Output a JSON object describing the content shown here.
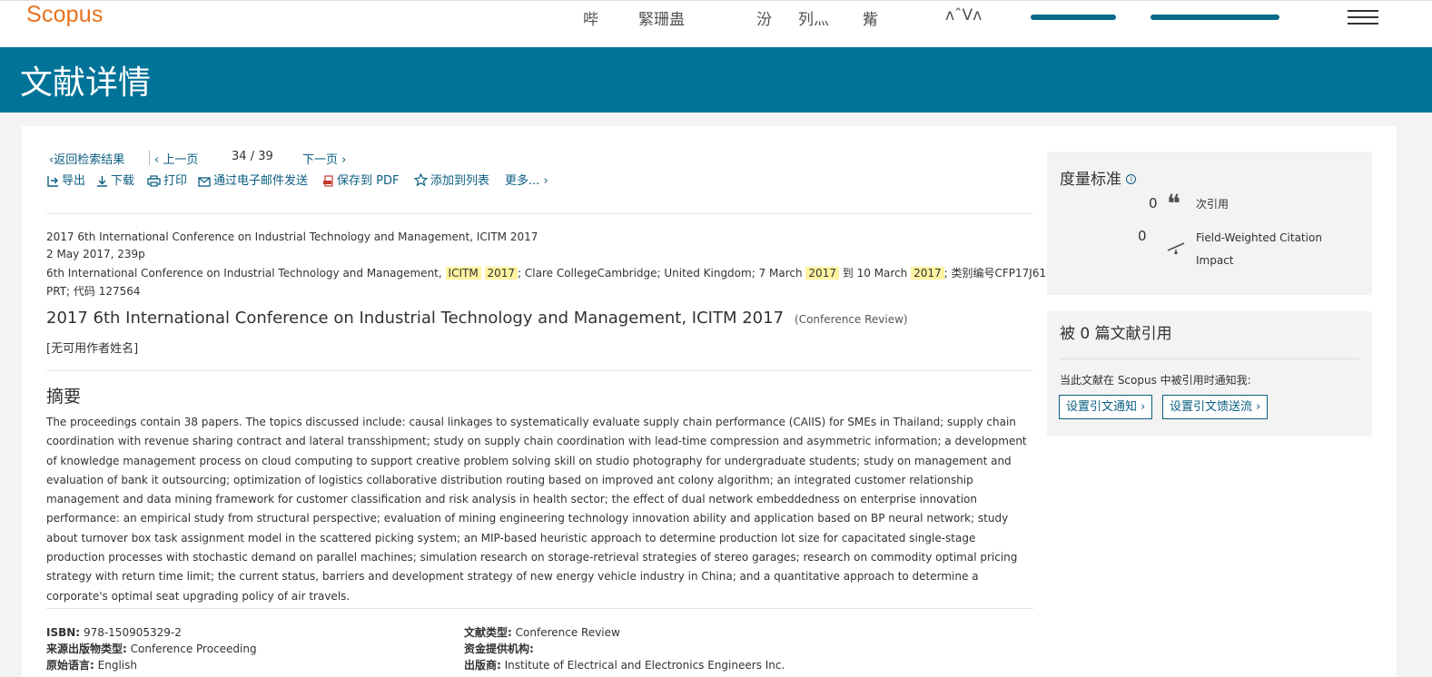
{
  "header": {
    "logo": "Scopus",
    "garbled_nav": [
      "哔",
      "緊珊蛊",
      "汾",
      "列灬",
      "觜",
      "ᴧˆVʌ"
    ]
  },
  "banner": {
    "title": "文献详情"
  },
  "nav": {
    "back": "返回检索结果",
    "prev": "上一页",
    "current": "34",
    "slash": "/",
    "total": "39",
    "next": "下一页"
  },
  "toolbar": {
    "export": "导出",
    "download": "下载",
    "print": "打印",
    "email": "通过电子邮件发送",
    "pdf": "保存到 PDF",
    "add_list": "添加到列表",
    "more": "更多..."
  },
  "source": {
    "line1": "2017 6th International Conference on Industrial Technology and Management, ICITM 2017",
    "line2": "2 May 2017, 239p",
    "line3_a": "6th International Conference on Industrial Technology and Management,",
    "hl1": "ICITM",
    "hl2": "2017",
    "line3_b": "; Clare CollegeCambridge; United Kingdom; 7 March",
    "hl3": "2017",
    "line3_c": "到 10 March",
    "hl4": "2017",
    "line3_d": "; 类别编号CFP17J61-",
    "line4": "PRT; 代码 127564"
  },
  "document": {
    "title": "2017 6th International Conference on Industrial Technology and Management, ICITM 2017",
    "type": "(Conference Review)",
    "authors": "[无可用作者姓名]"
  },
  "abstract": {
    "heading": "摘要",
    "text": "The proceedings contain 38 papers. The topics discussed include: causal linkages to systematically evaluate supply chain performance (CAlIS) for SMEs in Thailand; supply chain coordination with revenue sharing contract and lateral transshipment; study on supply chain coordination with lead-time compression and asymmetric information; a development of knowledge management process on cloud computing to support creative problem solving skill on studio photography for undergraduate students; study on management and evaluation of bank it outsourcing; optimization of logistics collaborative distribution routing based on improved ant colony algorithm; an integrated customer relationship management and data mining framework for customer classification and risk analysis in health sector; the effect of dual network embeddedness on enterprise innovation performance: an empirical study from structural perspective; evaluation of mining engineering technology innovation ability and application based on BP neural network; study about turnover box task assignment model in the scattered picking system; an MIP-based heuristic approach to determine production lot size for capacitated single-stage production processes with stochastic demand on parallel machines; simulation research on storage-retrieval strategies of stereo garages; research on commodity optimal pricing strategy with return time limit; the current status, barriers and development strategy of new energy vehicle industry in China; and a quantitative approach to determine a corporate's optimal seat upgrading policy of air travels."
  },
  "meta": {
    "isbn_label": "ISBN:",
    "isbn": "978-150905329-2",
    "source_type_label": "来源出版物类型:",
    "source_type": "Conference Proceeding",
    "language_label": "原始语言:",
    "language": "English",
    "doc_type_label": "文献类型:",
    "doc_type": "Conference Review",
    "funding_label": "资金提供机构:",
    "funding": "",
    "publisher_label": "出版商:",
    "publisher": "Institute of Electrical and Electronics Engineers Inc."
  },
  "metrics": {
    "heading": "度量标准",
    "citations": "0",
    "citations_label": "次引用",
    "fwci": "0",
    "fwci_label_1": "Field-Weighted Citation",
    "fwci_label_2": "Impact"
  },
  "cited_by": {
    "heading_a": "被",
    "count": "0",
    "heading_b": "篇文献引用",
    "notify_text": "当此文献在 Scopus 中被引用时通知我:",
    "btn_alert": "设置引文通知",
    "btn_feed": "设置引文馈送流"
  },
  "colors": {
    "brand": "#e9711c",
    "banner": "#007398",
    "link": "#0b5e82",
    "highlight": "#fff3a0"
  }
}
